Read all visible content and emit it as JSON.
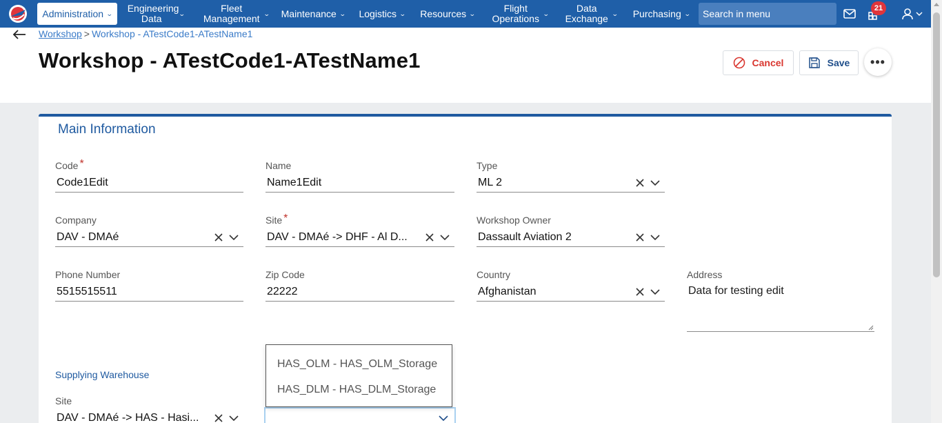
{
  "nav": {
    "items": [
      {
        "label": "Administration"
      },
      {
        "label": "Engineering Data"
      },
      {
        "label": "Fleet Management"
      },
      {
        "label": "Maintenance"
      },
      {
        "label": "Logistics"
      },
      {
        "label": "Resources"
      },
      {
        "label": "Flight Operations"
      },
      {
        "label": "Data Exchange"
      },
      {
        "label": "Purchasing"
      }
    ],
    "search_placeholder": "Search in menu",
    "notification_count": "21"
  },
  "breadcrumb": {
    "parent": "Workshop",
    "separator": ">",
    "current": "Workshop - ATestCode1-ATestName1"
  },
  "page_title": "Workshop - ATestCode1-ATestName1",
  "actions": {
    "cancel": "Cancel",
    "save": "Save",
    "more": "•••"
  },
  "main_info": {
    "title": "Main Information",
    "code": {
      "label": "Code",
      "required": "*",
      "value": "Code1Edit"
    },
    "name": {
      "label": "Name",
      "value": "Name1Edit"
    },
    "type": {
      "label": "Type",
      "value": "ML 2"
    },
    "company": {
      "label": "Company",
      "value": "DAV - DMAé"
    },
    "site": {
      "label": "Site",
      "required": "*",
      "value": "DAV - DMAé -> DHF - Al D..."
    },
    "workshop_owner": {
      "label": "Workshop Owner",
      "value": "Dassault Aviation 2"
    },
    "phone": {
      "label": "Phone Number",
      "value": "5515515511"
    },
    "zip": {
      "label": "Zip Code",
      "value": "22222"
    },
    "country": {
      "label": "Country",
      "value": "Afghanistan"
    },
    "address": {
      "label": "Address",
      "value": "Data for testing edit"
    }
  },
  "supplying_warehouse": {
    "title": "Supplying Warehouse",
    "site": {
      "label": "Site",
      "value": "DAV - DMAé -> HAS - Hasi..."
    },
    "dropdown_options": [
      "HAS_OLM - HAS_OLM_Storage",
      "HAS_DLM - HAS_DLM_Storage"
    ]
  },
  "colors": {
    "nav_bg": "#1f5fa8",
    "accent": "#1f5aa0",
    "cancel": "#d9362f",
    "badge": "#e0353b"
  }
}
